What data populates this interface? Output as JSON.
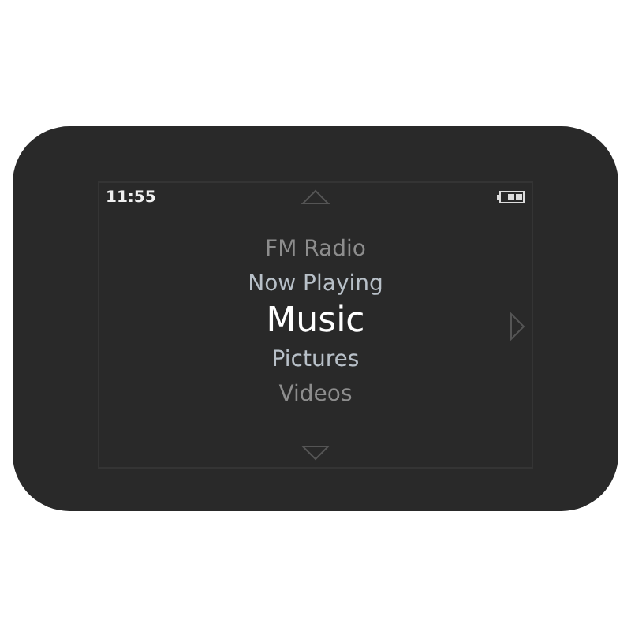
{
  "status_bar": {
    "time": "11:55"
  },
  "menu": {
    "items": [
      {
        "label": "FM Radio",
        "selected": false,
        "kind": "far"
      },
      {
        "label": "Now Playing",
        "selected": false,
        "kind": "near"
      },
      {
        "label": "Music",
        "selected": true
      },
      {
        "label": "Pictures",
        "selected": false,
        "kind": "near"
      },
      {
        "label": "Videos",
        "selected": false,
        "kind": "far"
      }
    ]
  }
}
